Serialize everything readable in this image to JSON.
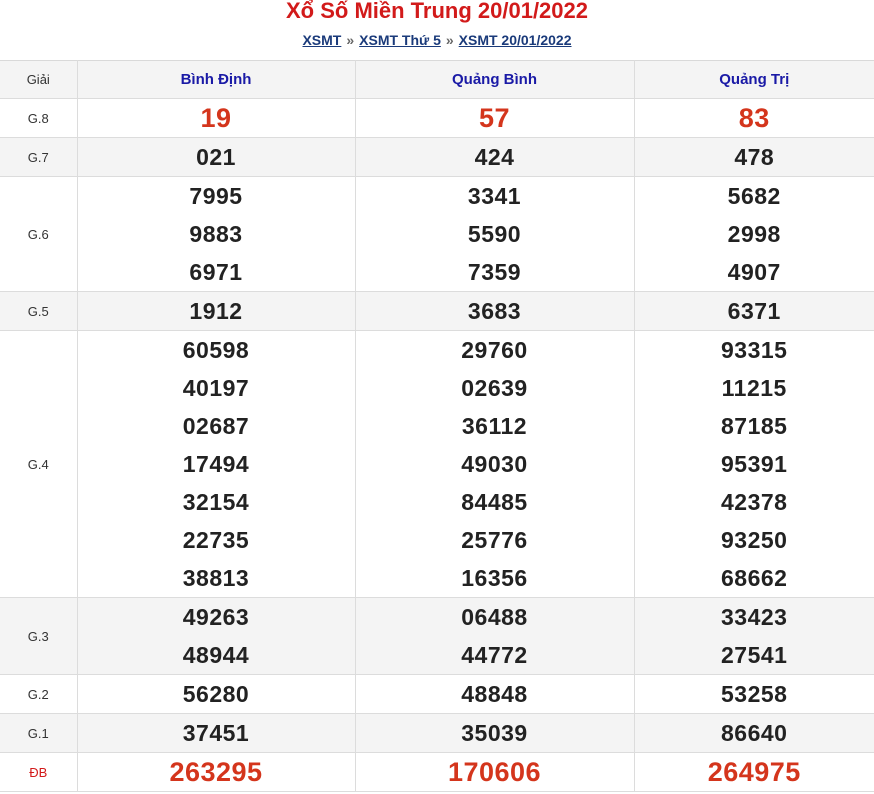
{
  "header": {
    "title": "Xổ Số Miền Trung 20/01/2022",
    "breadcrumb": [
      {
        "label": "XSMT"
      },
      {
        "label": "XSMT Thứ 5"
      },
      {
        "label": "XSMT 20/01/2022"
      }
    ],
    "separator": "»"
  },
  "table": {
    "label_header": "Giải",
    "provinces": [
      "Bình Định",
      "Quảng Bình",
      "Quảng Trị"
    ],
    "prizes": [
      {
        "label": "G.8",
        "values": [
          [
            "19"
          ],
          [
            "57"
          ],
          [
            "83"
          ]
        ]
      },
      {
        "label": "G.7",
        "values": [
          [
            "021"
          ],
          [
            "424"
          ],
          [
            "478"
          ]
        ]
      },
      {
        "label": "G.6",
        "values": [
          [
            "7995",
            "9883",
            "6971"
          ],
          [
            "3341",
            "5590",
            "7359"
          ],
          [
            "5682",
            "2998",
            "4907"
          ]
        ]
      },
      {
        "label": "G.5",
        "values": [
          [
            "1912"
          ],
          [
            "3683"
          ],
          [
            "6371"
          ]
        ]
      },
      {
        "label": "G.4",
        "values": [
          [
            "60598",
            "40197",
            "02687",
            "17494",
            "32154",
            "22735",
            "38813"
          ],
          [
            "29760",
            "02639",
            "36112",
            "49030",
            "84485",
            "25776",
            "16356"
          ],
          [
            "93315",
            "11215",
            "87185",
            "95391",
            "42378",
            "93250",
            "68662"
          ]
        ]
      },
      {
        "label": "G.3",
        "values": [
          [
            "49263",
            "48944"
          ],
          [
            "06488",
            "44772"
          ],
          [
            "33423",
            "27541"
          ]
        ]
      },
      {
        "label": "G.2",
        "values": [
          [
            "56280"
          ],
          [
            "48848"
          ],
          [
            "53258"
          ]
        ]
      },
      {
        "label": "G.1",
        "values": [
          [
            "37451"
          ],
          [
            "35039"
          ],
          [
            "86640"
          ]
        ]
      },
      {
        "label": "ĐB",
        "values": [
          [
            "263295"
          ],
          [
            "170606"
          ],
          [
            "264975"
          ]
        ]
      }
    ]
  },
  "colors": {
    "title": "#d21a1a",
    "province": "#1a1aa6",
    "highlight": "#d4351c",
    "link": "#1a3a7a"
  }
}
